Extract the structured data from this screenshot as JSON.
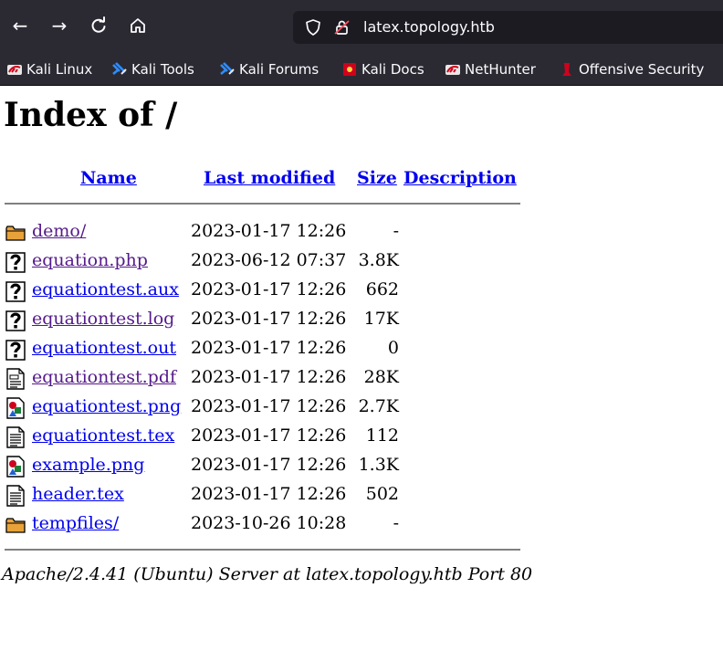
{
  "browser": {
    "url": "latex.topology.htb",
    "nav_icons": [
      "back-icon",
      "forward-icon",
      "reload-icon",
      "home-icon"
    ],
    "bookmarks": [
      {
        "label": "Kali Linux",
        "icon": "kali-dragon-icon"
      },
      {
        "label": "Kali Tools",
        "icon": "kali-tools-icon"
      },
      {
        "label": "Kali Forums",
        "icon": "kali-forums-icon"
      },
      {
        "label": "Kali Docs",
        "icon": "kali-docs-icon"
      },
      {
        "label": "NetHunter",
        "icon": "nethunter-icon"
      },
      {
        "label": "Offensive Security",
        "icon": "offensive-security-icon"
      }
    ]
  },
  "page": {
    "title": "Index of /",
    "columns": {
      "name": "Name",
      "last_modified": "Last modified",
      "size": "Size",
      "description": "Description"
    },
    "rows": [
      {
        "name": "demo/",
        "date": "2023-01-17 12:26",
        "size": "-",
        "icon": "folder-icon",
        "visited": true
      },
      {
        "name": "equation.php",
        "date": "2023-06-12 07:37",
        "size": "3.8K",
        "icon": "unknown-file-icon",
        "visited": true
      },
      {
        "name": "equationtest.aux",
        "date": "2023-01-17 12:26",
        "size": "662",
        "icon": "unknown-file-icon",
        "visited": false
      },
      {
        "name": "equationtest.log",
        "date": "2023-01-17 12:26",
        "size": "17K",
        "icon": "unknown-file-icon",
        "visited": true
      },
      {
        "name": "equationtest.out",
        "date": "2023-01-17 12:26",
        "size": "0",
        "icon": "unknown-file-icon",
        "visited": false
      },
      {
        "name": "equationtest.pdf",
        "date": "2023-01-17 12:26",
        "size": "28K",
        "icon": "layout-file-icon",
        "visited": true
      },
      {
        "name": "equationtest.png",
        "date": "2023-01-17 12:26",
        "size": "2.7K",
        "icon": "image-file-icon",
        "visited": false
      },
      {
        "name": "equationtest.tex",
        "date": "2023-01-17 12:26",
        "size": "112",
        "icon": "text-file-icon",
        "visited": false
      },
      {
        "name": "example.png",
        "date": "2023-01-17 12:26",
        "size": "1.3K",
        "icon": "image-file-icon",
        "visited": false
      },
      {
        "name": "header.tex",
        "date": "2023-01-17 12:26",
        "size": "502",
        "icon": "text-file-icon",
        "visited": false
      },
      {
        "name": "tempfiles/",
        "date": "2023-10-26 10:28",
        "size": "-",
        "icon": "folder-icon",
        "visited": false
      }
    ],
    "footer": "Apache/2.4.41 (Ubuntu) Server at latex.topology.htb Port 80"
  },
  "colors": {
    "link": "#0000ee",
    "visited_link": "#551a8b",
    "chrome_bg": "#2b2a33",
    "urlbar_bg": "#1c1b22"
  }
}
